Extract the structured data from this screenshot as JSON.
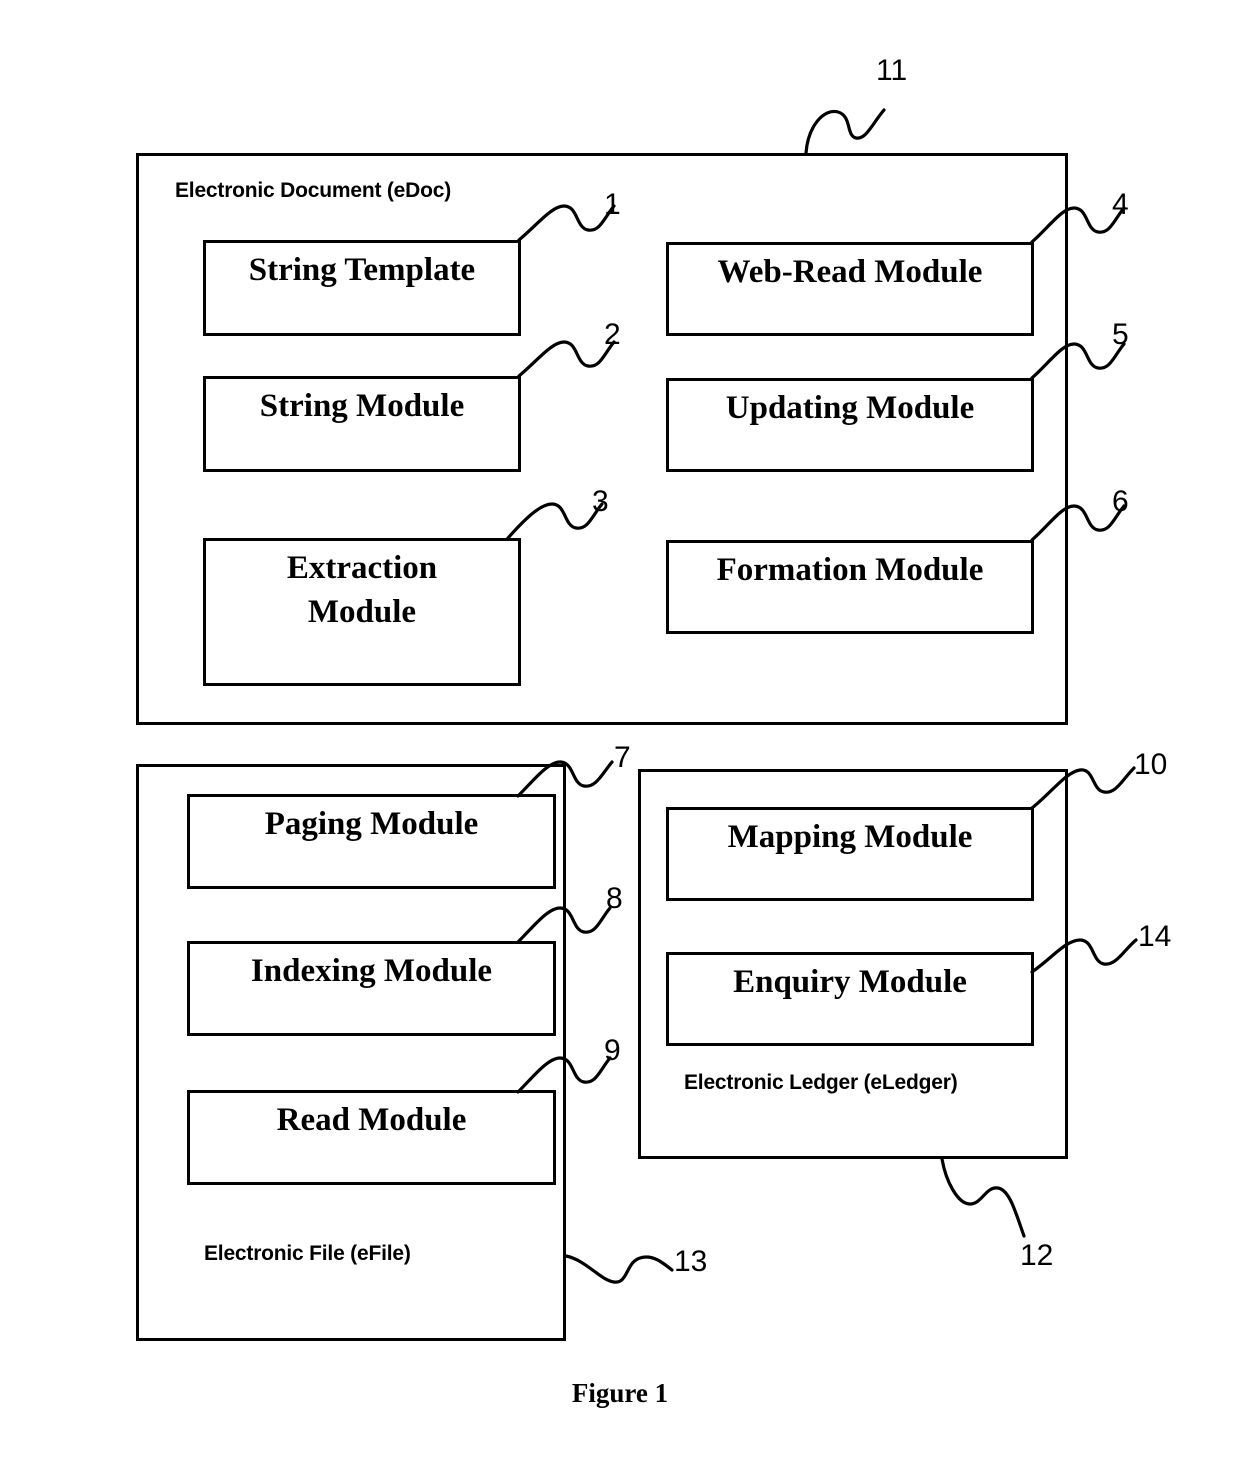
{
  "figure": {
    "caption": "Figure 1"
  },
  "panels": [
    {
      "id": "edoc",
      "caption": "Electronic Document (eDoc)",
      "ref": "11"
    },
    {
      "id": "efile",
      "caption": "Electronic File (eFile)",
      "ref": "13"
    },
    {
      "id": "eledger",
      "caption": "Electronic Ledger (eLedger)",
      "ref": "12"
    }
  ],
  "modules": {
    "string_template": {
      "label": "String Template",
      "ref": "1"
    },
    "string_module": {
      "label": "String Module",
      "ref": "2"
    },
    "extraction": {
      "label": "Extraction\nModule",
      "ref": "3"
    },
    "web_read": {
      "label": "Web-Read Module",
      "ref": "4"
    },
    "updating": {
      "label": "Updating Module",
      "ref": "5"
    },
    "formation": {
      "label": "Formation Module",
      "ref": "6"
    },
    "paging": {
      "label": "Paging Module",
      "ref": "7"
    },
    "indexing": {
      "label": "Indexing Module",
      "ref": "8"
    },
    "read": {
      "label": "Read Module",
      "ref": "9"
    },
    "mapping": {
      "label": "Mapping Module",
      "ref": "10"
    },
    "enquiry": {
      "label": "Enquiry Module",
      "ref": "14"
    }
  },
  "refs": {
    "r1": "1",
    "r2": "2",
    "r3": "3",
    "r4": "4",
    "r5": "5",
    "r6": "6",
    "r7": "7",
    "r8": "8",
    "r9": "9",
    "r10": "10",
    "r11": "11",
    "r12": "12",
    "r13": "13",
    "r14": "14"
  },
  "colors": {
    "stroke": "#000000",
    "background": "#ffffff"
  }
}
